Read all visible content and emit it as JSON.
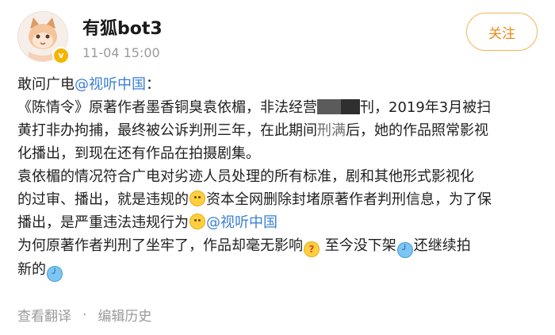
{
  "header": {
    "username": "有狐bot3",
    "timestamp": "11-04 15:00",
    "follow_label": "关注"
  },
  "post": {
    "line1_prefix": "敢问广电",
    "mention": "@视听中国",
    "line1_suffix": "：",
    "line2_start": "《陈情令》原著作者墨香铜臭袁依楣，非法经营",
    "line2_end": "刊，2019年3月被扫",
    "line3_start": "黄打非办拘捕，最终被公诉判刑三年，在此期间",
    "line3_blur": "刑满",
    "line3_end": "后，她的作品照常影视",
    "line4": "化播出，到现在还有作品在拍摄剧集。",
    "line5": "袁依楣的情况符合广电对劣迹人员处理的所有标准，剧和其他形式影视化",
    "line6_a": "的过审、播出，就是违规的",
    "line6_b": "资本全网删除封堵原著作者判刑信息，为了保",
    "line7": "播出，是严重违法违规行为",
    "line8_a": "为何原著作者判刑了坐牢了，作品却毫无影响",
    "line8_b": " 至今没下架",
    "line8_c": "还继续拍",
    "line9": "新的"
  },
  "footer": {
    "translate_label": "查看翻译",
    "separator": "·",
    "history_label": "编辑历史"
  },
  "colors": {
    "mention": "#3a7fd5",
    "follow": "#ee8a16",
    "timestamp": "#9a9a9a",
    "verified_badge": "#f5b400"
  },
  "icons": {
    "avatar": "fox-avatar",
    "verified": "verified-badge-icon",
    "smile": "smile-emoji-icon",
    "question": "question-emoji-icon",
    "shrug": "shrug-emoji-icon"
  }
}
